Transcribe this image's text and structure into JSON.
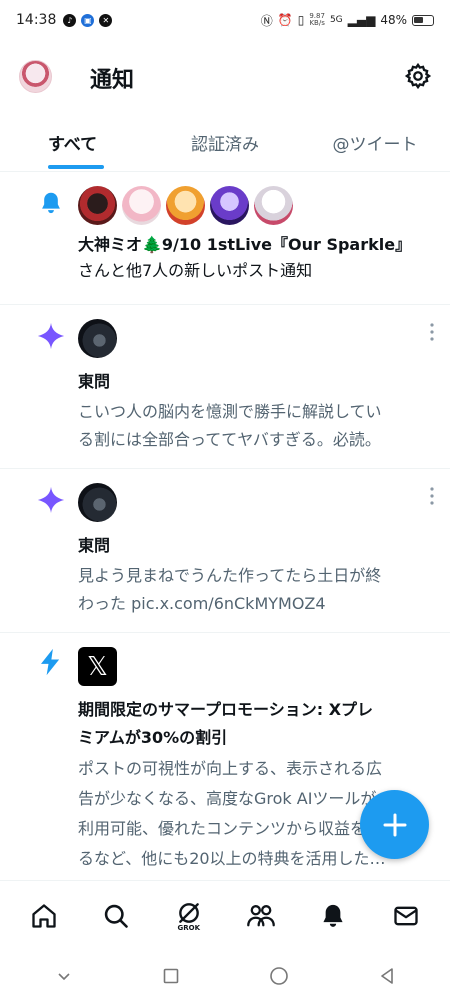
{
  "status_bar": {
    "time": "14:38",
    "net_speed": "9.87",
    "net_unit": "KB/s",
    "signal": "5G",
    "battery": "48%"
  },
  "header": {
    "title": "通知"
  },
  "tabs": [
    {
      "label": "すべて",
      "active": true
    },
    {
      "label": "認証済み",
      "active": false
    },
    {
      "label": "@ツイート",
      "active": false
    }
  ],
  "notifications": [
    {
      "icon": "bell-icon",
      "title": "大神ミオ🌲9/10 1stLive『Our Sparkle』",
      "text": "さんと他7人の新しいポスト通知"
    },
    {
      "icon": "sparkle-icon",
      "title": "東問",
      "line1": "こいつ人の脳内を憶測で勝手に解説してい",
      "line2": "る割には全部合っててヤバすぎる。必読。"
    },
    {
      "icon": "sparkle-icon",
      "title": "東問",
      "line1": "見よう見まねでうんた作ってたら土日が終",
      "line2": "わった pic.x.com/6nCkMYMOZ4"
    },
    {
      "icon": "lightning-icon",
      "title_line1": "期間限定のサマープロモーション: Xプレ",
      "title_line2": "ミアムが30%の割引",
      "line1": "ポストの可視性が向上する、表示される広",
      "line2": "告が少なくなる、高度なGrok AIツールが",
      "line3": "利用可能、優れたコンテンツから収益を得",
      "line4": "るなど、他にも20以上の特典を活用した…"
    }
  ],
  "bottom_nav": {
    "grok_label": "GROK"
  },
  "colors": {
    "accent": "#1d9bf0",
    "sparkle": "#7856ff",
    "text": "#0f1419",
    "muted": "#536471"
  }
}
